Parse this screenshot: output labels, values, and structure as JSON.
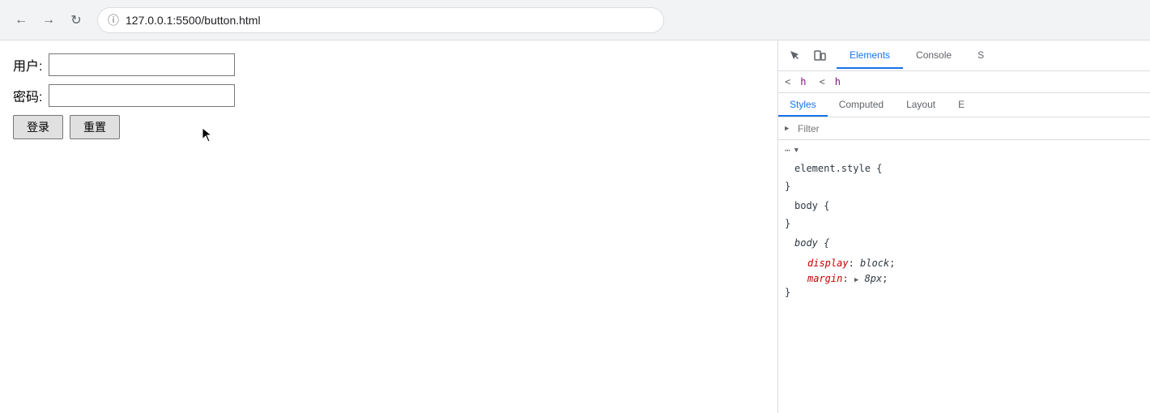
{
  "browser": {
    "url": "127.0.0.1:5500/button.html",
    "back_disabled": false,
    "forward_disabled": true
  },
  "page": {
    "username_label": "用户:",
    "password_label": "密码:",
    "login_button": "登录",
    "reset_button": "重置"
  },
  "devtools": {
    "tabs": [
      {
        "label": "Elements",
        "active": true
      },
      {
        "label": "Console",
        "active": false
      },
      {
        "label": "S",
        "active": false
      }
    ],
    "sub_tabs": [
      {
        "label": "Styles",
        "active": true
      },
      {
        "label": "Computed",
        "active": false
      },
      {
        "label": "Layout",
        "active": false
      },
      {
        "label": "E",
        "active": false
      }
    ],
    "breadcrumb_lt": "<",
    "breadcrumb_tag": "h",
    "breadcrumb_lt2": "<",
    "breadcrumb_tag2": "h",
    "filter_placeholder": "Filter",
    "rules": [
      {
        "id": "element_style",
        "selector": "element.style {",
        "closing": "}",
        "properties": []
      },
      {
        "id": "body_rule1",
        "selector": "body {",
        "closing": "}",
        "properties": []
      },
      {
        "id": "body_rule2",
        "selector": "body {",
        "closing": "}",
        "properties": [
          {
            "name": "display",
            "value": "block"
          },
          {
            "name": "margin",
            "value": "▶ 8px"
          }
        ]
      }
    ]
  }
}
